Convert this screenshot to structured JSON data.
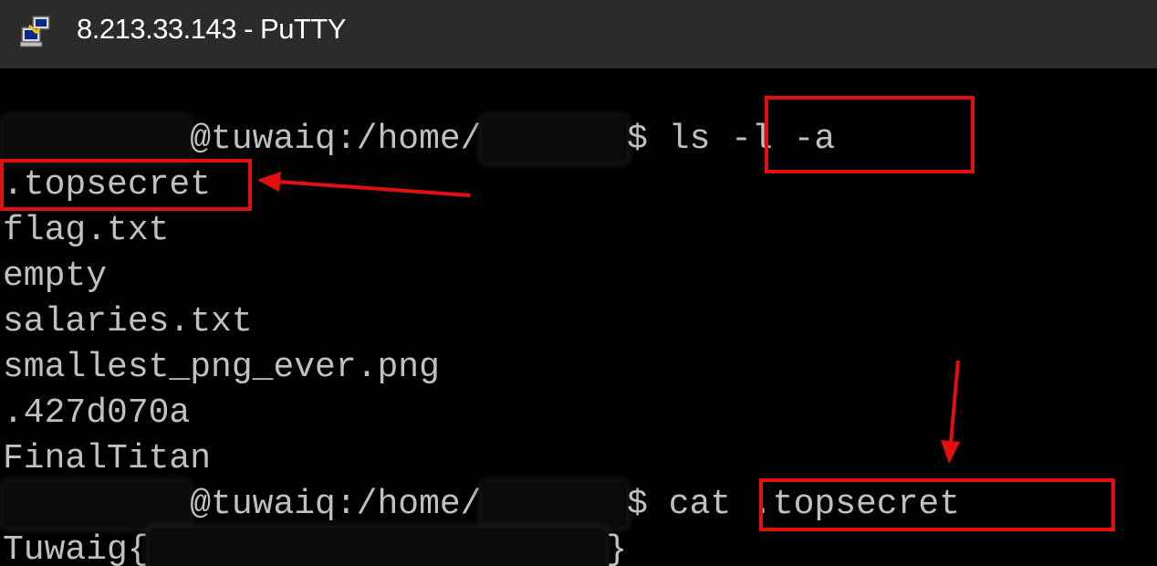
{
  "window": {
    "title": "8.213.33.143 - PuTTY"
  },
  "terminal": {
    "prompt1": {
      "host": "@tuwaiq:/home/",
      "symbol": "$",
      "command": "ls -l -a"
    },
    "listing": [
      ".topsecret",
      "flag.txt",
      "empty",
      "salaries.txt",
      "smallest_png_ever.png",
      ".427d070a",
      "FinalTitan"
    ],
    "prompt2": {
      "host": "@tuwaiq:/home/",
      "symbol": "$",
      "command": "cat .topsecret"
    },
    "output": {
      "prefix": "Tuwaig{",
      "suffix": "}"
    }
  },
  "colors": {
    "terminal_text": "#c0c0c0",
    "terminal_bg": "#000000",
    "titlebar_bg": "#2b2b2b",
    "annotation": "#e30f0f"
  },
  "icons": {
    "app": "putty-icon"
  }
}
